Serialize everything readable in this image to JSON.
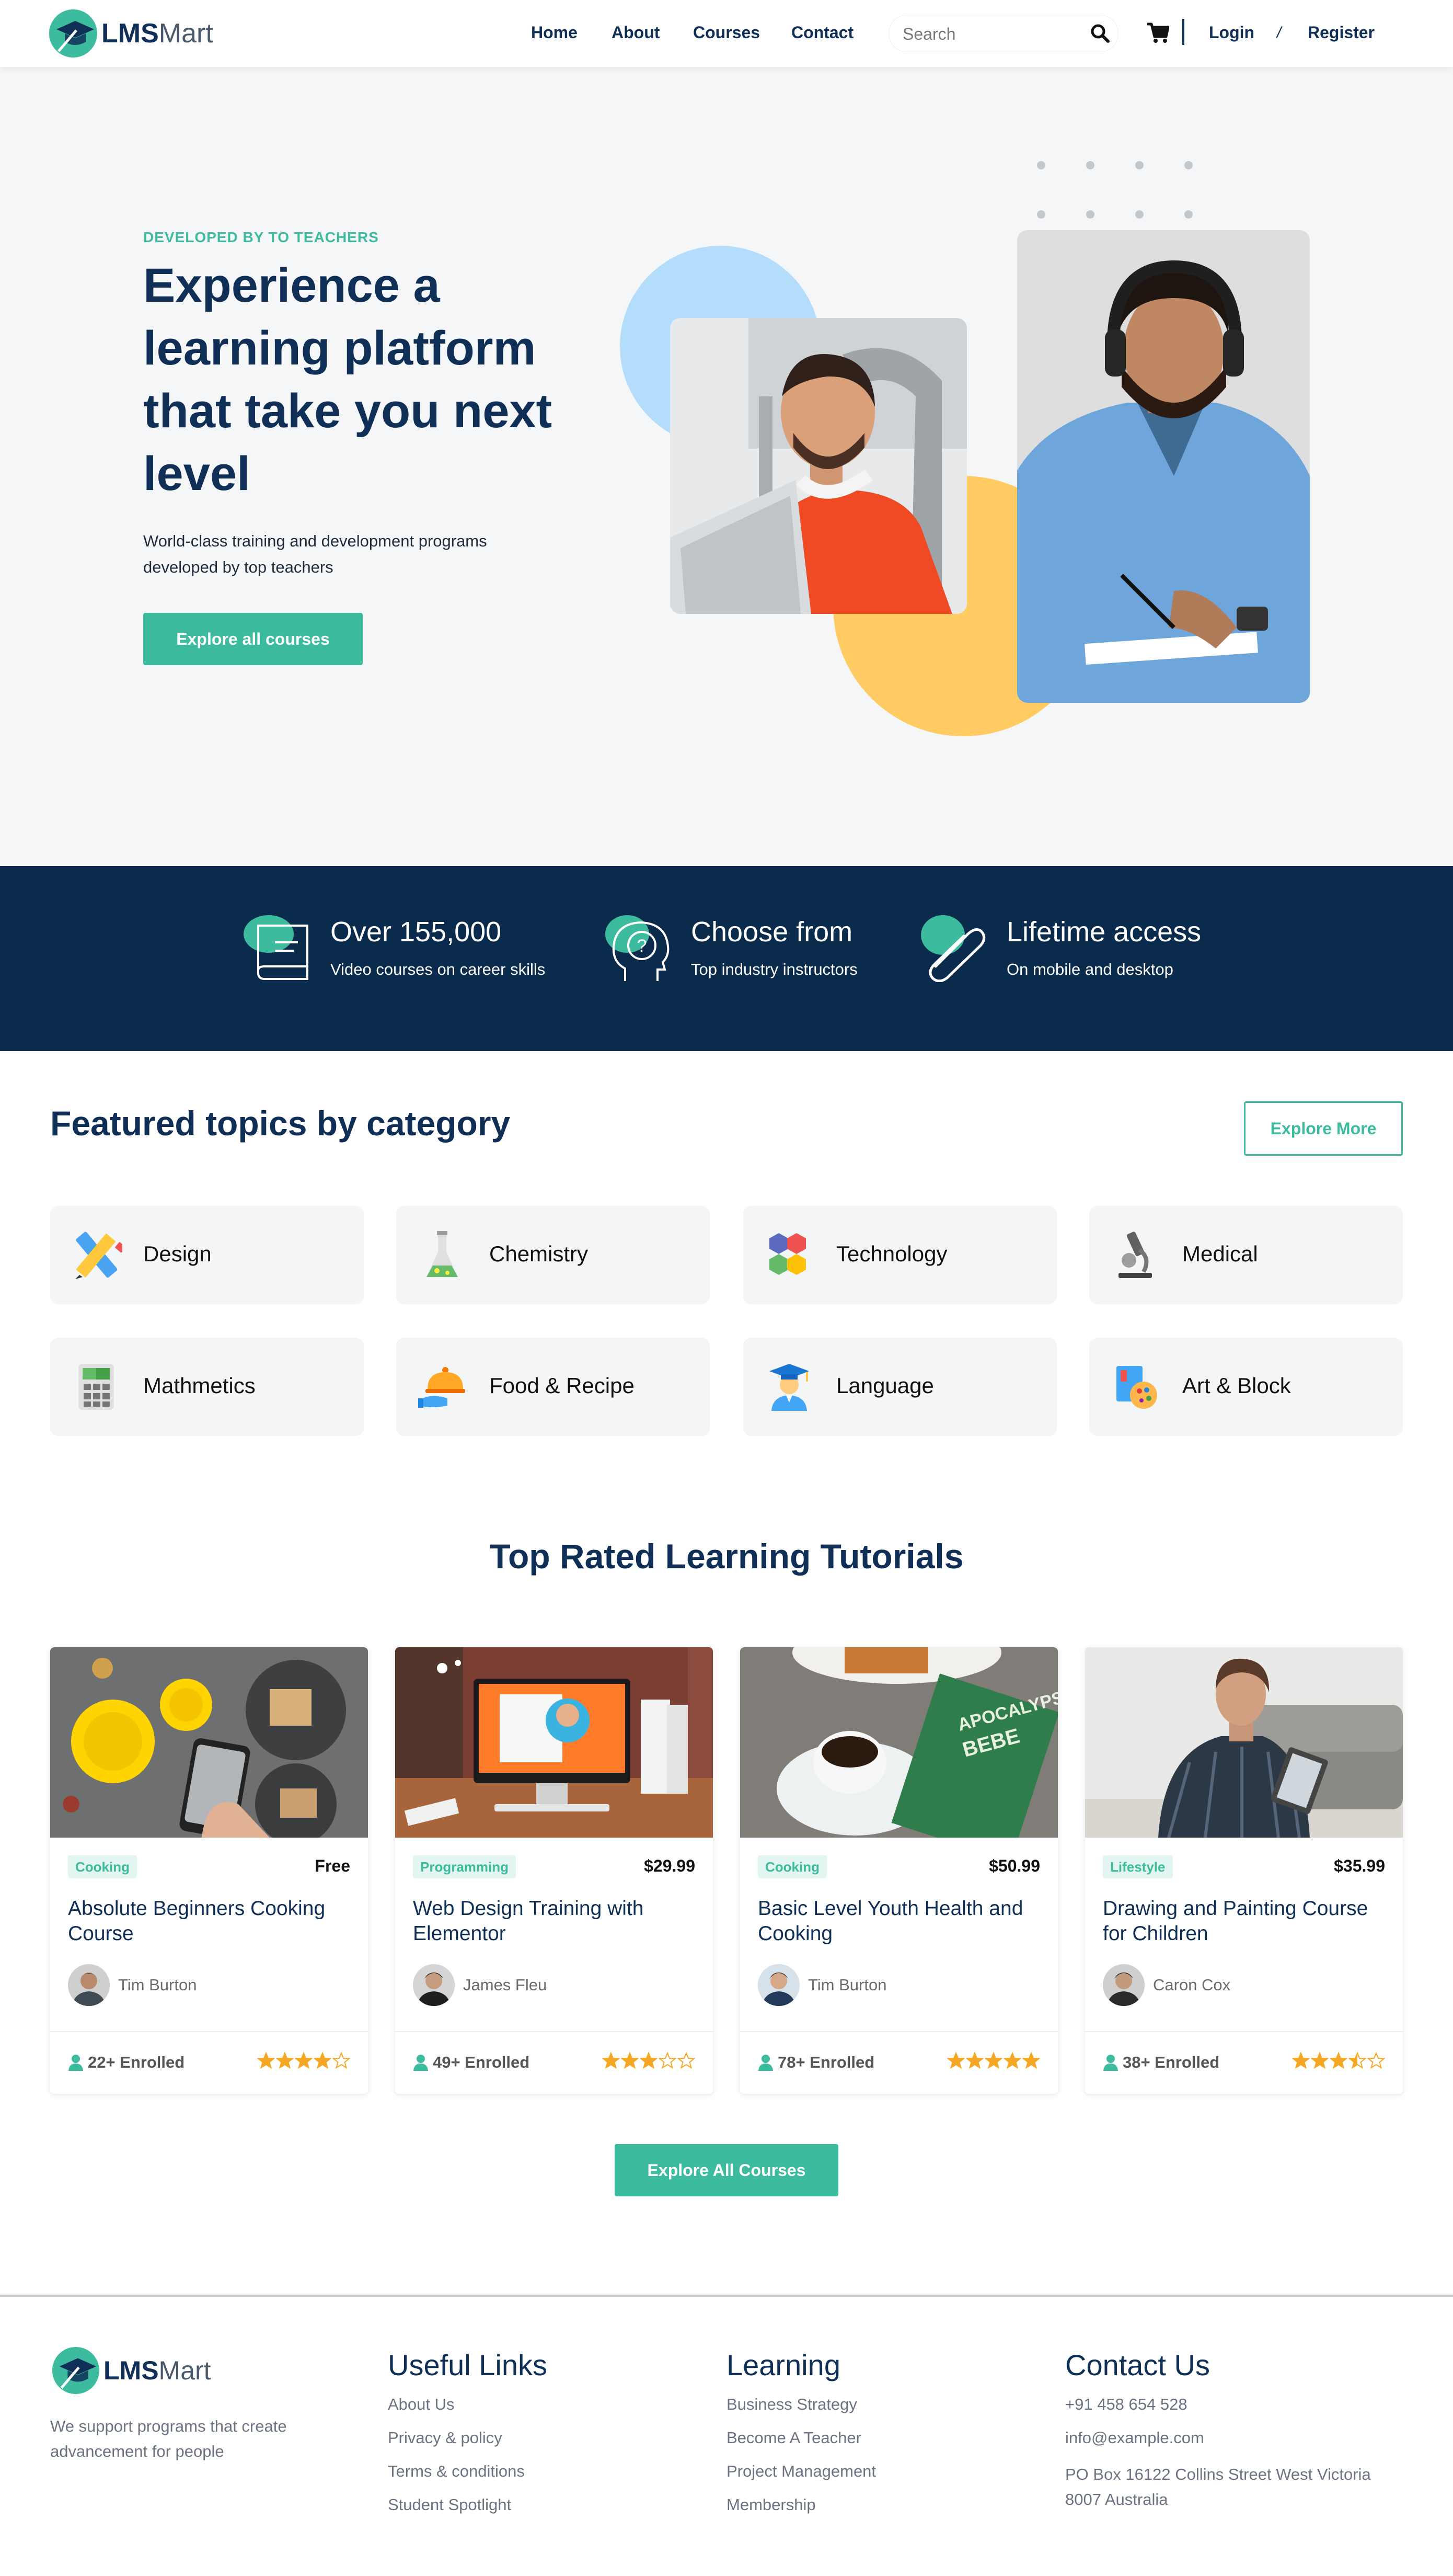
{
  "brand": {
    "name_bold": "LMS",
    "name_light": "Mart"
  },
  "nav": {
    "links": [
      "Home",
      "About",
      "Courses",
      "Contact"
    ],
    "search_placeholder": "Search",
    "login": "Login",
    "separator": "/",
    "register": "Register"
  },
  "hero": {
    "eyebrow": "DEVELOPED BY TO TEACHERS",
    "title": "Experience a learning platform that take you next level",
    "subtitle": "World-class training and development programs developed by top teachers",
    "cta": "Explore all courses"
  },
  "stats": [
    {
      "title": "Over 155,000",
      "subtitle": "Video courses on career skills",
      "icon": "book-icon"
    },
    {
      "title": "Choose from",
      "subtitle": "Top industry instructors",
      "icon": "head-question-icon"
    },
    {
      "title": "Lifetime access",
      "subtitle": "On mobile and desktop",
      "icon": "paperclip-icon"
    }
  ],
  "categories": {
    "title": "Featured topics by category",
    "button": "Explore More",
    "items": [
      {
        "label": "Design",
        "icon": "pencil-ruler-icon"
      },
      {
        "label": "Chemistry",
        "icon": "flask-icon"
      },
      {
        "label": "Technology",
        "icon": "hexagons-icon"
      },
      {
        "label": "Medical",
        "icon": "microscope-icon"
      },
      {
        "label": "Mathmetics",
        "icon": "calculator-icon"
      },
      {
        "label": "Food & Recipe",
        "icon": "cloche-icon"
      },
      {
        "label": "Language",
        "icon": "graduate-icon"
      },
      {
        "label": "Art & Block",
        "icon": "palette-icon"
      }
    ]
  },
  "courses": {
    "title": "Top Rated Learning Tutorials",
    "button": "Explore All Courses",
    "items": [
      {
        "tag": "Cooking",
        "price": "Free",
        "title": "Absolute Beginners Cooking Course",
        "author": "Tim Burton",
        "enrolled": "22+ Enrolled",
        "rating": 4
      },
      {
        "tag": "Programming",
        "price": "$29.99",
        "title": "Web Design Training with Elementor",
        "author": "James Fleu",
        "enrolled": "49+ Enrolled",
        "rating": 3
      },
      {
        "tag": "Cooking",
        "price": "$50.99",
        "title": "Basic Level Youth Health and Cooking",
        "author": "Tim Burton",
        "enrolled": "78+ Enrolled",
        "rating": 5
      },
      {
        "tag": "Lifestyle",
        "price": "$35.99",
        "title": "Drawing and Painting Course for Children",
        "author": "Caron Cox",
        "enrolled": "38+ Enrolled",
        "rating": 3.5
      }
    ]
  },
  "footer": {
    "about": "We support programs that create advancement for people",
    "useful_links": {
      "title": "Useful Links",
      "items": [
        "About Us",
        "Privacy & policy",
        "Terms & conditions",
        "Student Spotlight"
      ]
    },
    "learning": {
      "title": "Learning",
      "items": [
        "Business Strategy",
        "Become A Teacher",
        "Project Management",
        "Membership"
      ]
    },
    "contact": {
      "title": "Contact Us",
      "phone": "+91 458 654 528",
      "email": "info@example.com",
      "address": "PO Box 16122 Collins Street West Victoria 8007 Australia"
    }
  },
  "colors": {
    "accent": "#3dbb9e",
    "navy": "#0f2f57",
    "stats_bg": "#0b2b4c",
    "star": "#f5a623",
    "hero_bg": "#f5f6f8"
  }
}
